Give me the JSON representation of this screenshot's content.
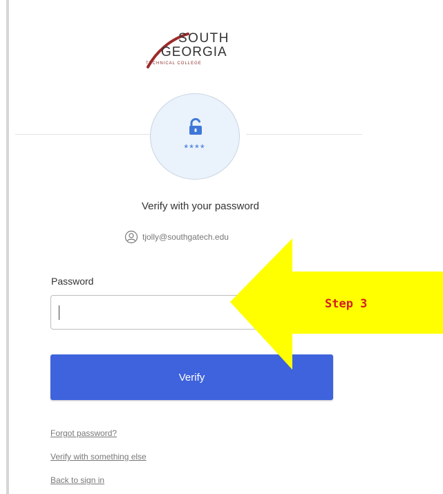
{
  "logo": {
    "line1": "SOUTH",
    "line2": "GEORGIA",
    "line3": "TECHNICAL COLLEGE"
  },
  "lock_badge": {
    "icon": "padlock-icon",
    "mask": "****"
  },
  "title": "Verify with your password",
  "identity": {
    "icon": "user-circle-icon",
    "username": "tjolly@southgatech.edu"
  },
  "password": {
    "label": "Password",
    "value": "",
    "placeholder": ""
  },
  "verify_button": {
    "label": "Verify"
  },
  "links": {
    "forgot": "Forgot password?",
    "other": "Verify with something else",
    "back": "Back to sign in"
  },
  "annotation": {
    "text": "Step 3",
    "arrow_color": "#ffff00",
    "text_color": "#d21f1f"
  },
  "colors": {
    "primary_button": "#3e63dd",
    "lock_badge_bg": "#eaf2fb",
    "brand_swoosh": "#9c2a2a"
  }
}
